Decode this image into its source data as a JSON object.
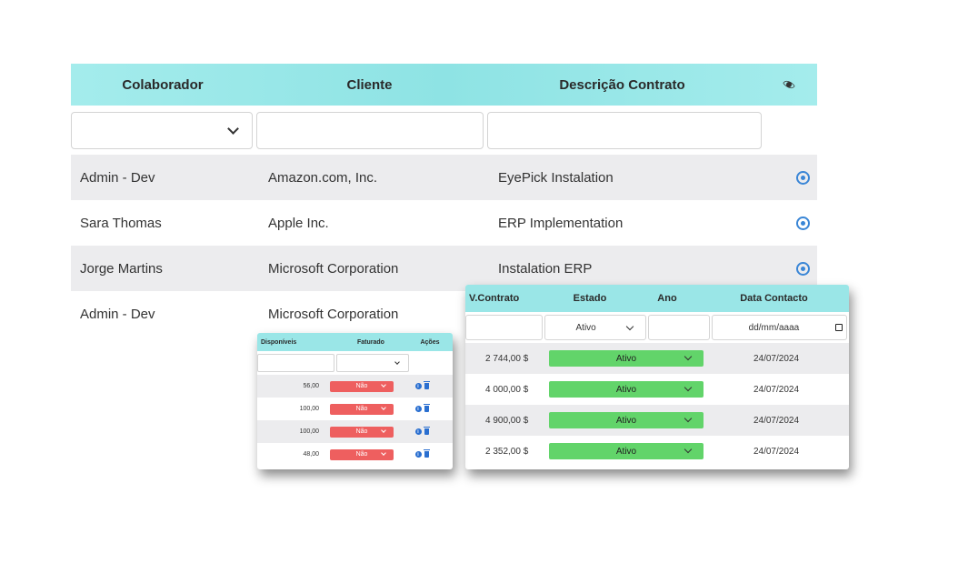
{
  "main_table": {
    "headers": {
      "colaborador": "Colaborador",
      "cliente": "Cliente",
      "descricao": "Descrição Contrato"
    },
    "rows": [
      {
        "colaborador": "Admin - Dev",
        "cliente": "Amazon.com, Inc.",
        "descricao": "EyePick Instalation"
      },
      {
        "colaborador": "Sara Thomas",
        "cliente": "Apple Inc.",
        "descricao": "ERP Implementation"
      },
      {
        "colaborador": "Jorge Martins",
        "cliente": "Microsoft Corporation",
        "descricao": "Instalation ERP"
      },
      {
        "colaborador": "Admin - Dev",
        "cliente": "Microsoft Corporation",
        "descricao": ""
      }
    ]
  },
  "contract_panel": {
    "headers": {
      "valor": "V.Contrato",
      "estado": "Estado",
      "ano": "Ano",
      "data": "Data Contacto"
    },
    "filters": {
      "estado_selected": "Ativo",
      "date_placeholder": "dd/mm/aaaa"
    },
    "rows": [
      {
        "valor": "2 744,00 $",
        "estado": "Ativo",
        "data": "24/07/2024"
      },
      {
        "valor": "4 000,00 $",
        "estado": "Ativo",
        "data": "24/07/2024"
      },
      {
        "valor": "4 900,00 $",
        "estado": "Ativo",
        "data": "24/07/2024"
      },
      {
        "valor": "2 352,00 $",
        "estado": "Ativo",
        "data": "24/07/2024"
      }
    ],
    "status_color": "#62d46a"
  },
  "billing_panel": {
    "headers": {
      "disponiveis": "Disponíveis",
      "faturado": "Faturado",
      "acoes": "Ações"
    },
    "rows": [
      {
        "disponiveis": "56,00",
        "faturado": "Não"
      },
      {
        "disponiveis": "100,00",
        "faturado": "Não"
      },
      {
        "disponiveis": "100,00",
        "faturado": "Não"
      },
      {
        "disponiveis": "48,00",
        "faturado": "Não"
      }
    ],
    "status_color": "#ee5f5f"
  },
  "colors": {
    "header_teal": "#9ae6e7",
    "icon_blue": "#3a86d6",
    "row_stripe": "#ececee"
  },
  "icons": {
    "column_toggle": "eye-icon",
    "row_view": "eye-icon",
    "info": "info-icon",
    "delete": "trash-icon"
  }
}
